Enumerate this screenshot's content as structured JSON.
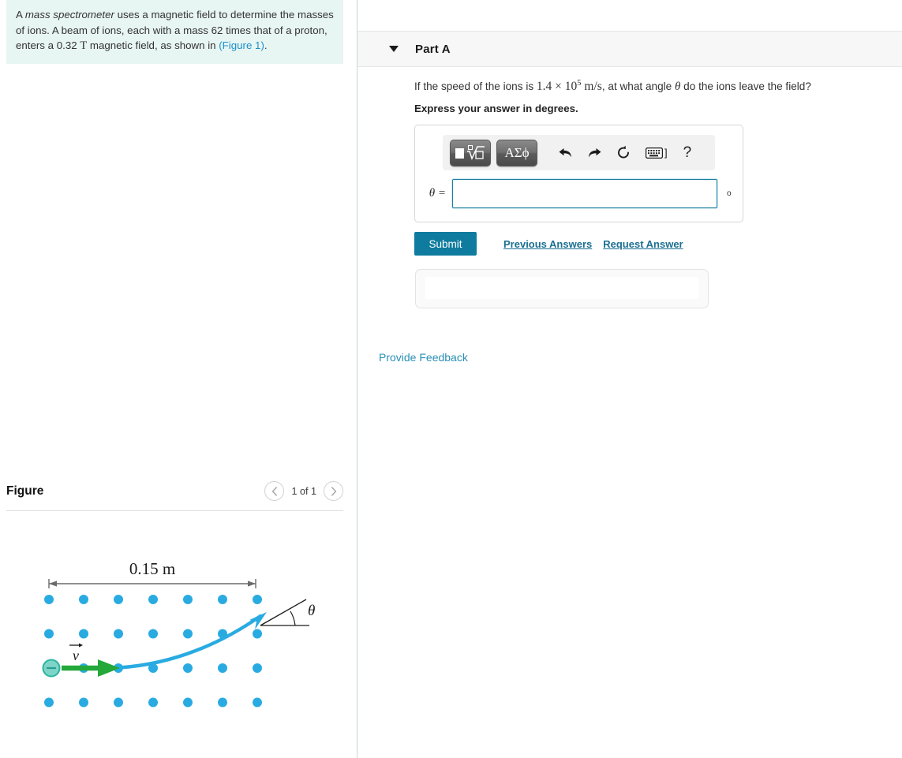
{
  "problem": {
    "text_part1": "A ",
    "emphasis": "mass spectrometer",
    "text_part2": " uses a magnetic field to determine the masses of ions. A beam of ions, each with a mass 62 times that of a proton, enters a ",
    "field_value": "0.32",
    "field_unit": "T",
    "text_part3": " magnetic field, as shown in ",
    "figure_link": "(Figure 1)",
    "text_end": "."
  },
  "figure": {
    "title": "Figure",
    "counter": "1 of 1",
    "prev_icon": "chevron-left-icon",
    "next_icon": "chevron-right-icon",
    "diagram": {
      "width_label": "0.15 m",
      "velocity_label": "v",
      "angle_label": "θ",
      "ion_charge": "−",
      "field_dot_color": "#29abe2",
      "trajectory_color": "#29abe2",
      "velocity_arrow_color": "#23a839",
      "ion_fill_color": "#7fd4c8",
      "ion_stroke_color": "#2bb5a0",
      "dimension_line_color": "#6b6b6b",
      "dots_columns": 7,
      "dots_rows": 4
    }
  },
  "part_a": {
    "caret_icon": "caret-down-icon",
    "title": "Part A",
    "question": {
      "lead": "If the speed of the ions is ",
      "speed_mantissa": "1.4",
      "speed_times": "×",
      "speed_base": "10",
      "speed_exponent": "5",
      "speed_unit": "m/s",
      "mid": ", at what angle ",
      "angle_symbol": "θ",
      "tail": " do the ions leave the field?"
    },
    "instruction": "Express your answer in degrees."
  },
  "answer_widget": {
    "toolbar": {
      "template_button_label": "√",
      "template_icon": "math-template-icon",
      "greek_button_label": "ΑΣϕ",
      "greek_icon": "greek-symbols-icon",
      "undo_icon": "undo-arrow-icon",
      "redo_icon": "redo-arrow-icon",
      "reset_icon": "reset-refresh-icon",
      "keyboard_icon": "keyboard-icon",
      "keyboard_bracket": "]",
      "help_icon": "question-mark-icon",
      "help_label": "?"
    },
    "variable_label": "θ =",
    "input_value": "",
    "input_placeholder": "",
    "unit_suffix": "o"
  },
  "actions": {
    "submit_label": "Submit",
    "previous_answers_label": "Previous Answers",
    "request_answer_label": "Request Answer",
    "provide_feedback_label": "Provide Feedback",
    "submit_color": "#0f7b9e",
    "link_color": "#1b6f91",
    "feedback_link_color": "#2a8fb8"
  }
}
